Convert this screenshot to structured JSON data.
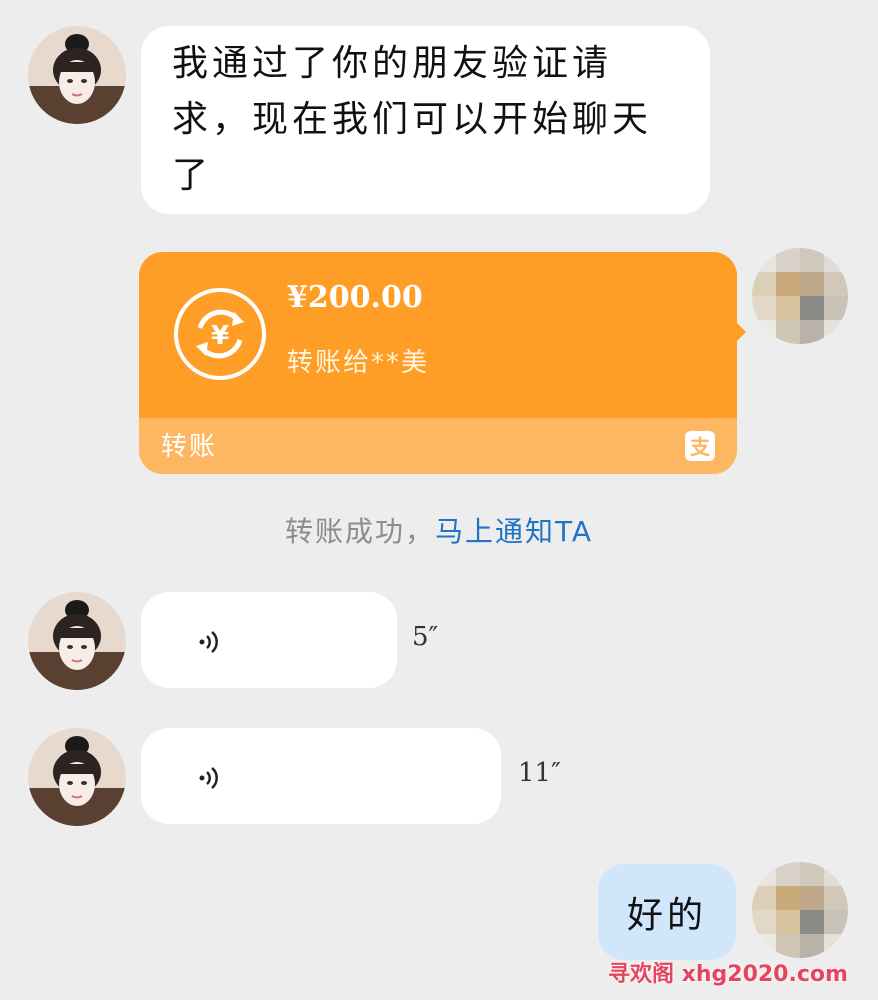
{
  "chat": {
    "messages": {
      "text_message": "我通过了你的朋友验证请求，现在我们可以开始聊天了",
      "transfer": {
        "amount": "¥200.00",
        "recipient": "转账给**美",
        "label": "转账",
        "icon": "currency-exchange-icon",
        "brand_icon": "alipay-icon",
        "color": "#fe9e27"
      },
      "system_notice": {
        "text": "转账成功，",
        "link": "马上通知TA"
      },
      "voice_1": {
        "duration": "5″"
      },
      "voice_2": {
        "duration": "11″"
      },
      "reply": "好的"
    }
  },
  "watermark": "寻欢阁 xhg2020.com",
  "colors": {
    "background": "#ededed",
    "bubble_white": "#ffffff",
    "bubble_self": "#cfe6fb",
    "link": "#1f74c6"
  }
}
